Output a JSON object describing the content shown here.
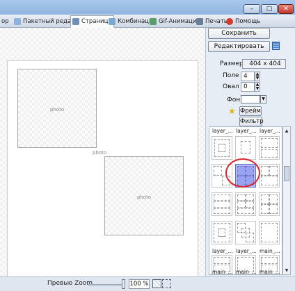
{
  "tabs": [
    {
      "label": "ор"
    },
    {
      "label": "Пакетный редактор"
    },
    {
      "label": "Страница"
    },
    {
      "label": "Комбинация"
    },
    {
      "label": "Gif-Анимация"
    },
    {
      "label": "Печать"
    },
    {
      "label": "Помощь"
    }
  ],
  "window": {
    "min_glyph": "–",
    "max_glyph": "□",
    "close_glyph": "✕"
  },
  "canvas": {
    "photo_label": "photo"
  },
  "statusbar": {
    "zoom_label": "Превью Zoom",
    "zoom_value": "100 %"
  },
  "panel": {
    "save_label": "Сохранить",
    "edit_label": "Редактировать",
    "size_label": "Размер",
    "size_value": "404 x 404",
    "margin_label": "Поле",
    "margin_value": "4",
    "oval_label": "Овал",
    "oval_value": "0",
    "bg_label": "Фон",
    "frame_label": "Фрейм",
    "filter_label": "Фильтр"
  },
  "thumbnails": {
    "row_labels_top": [
      "layer_...",
      "layer_...",
      "layer_..."
    ],
    "row_labels_bottom": [
      "layer_...",
      "layer_...",
      "main_..."
    ],
    "row_labels_last": [
      "main_...",
      "main_...",
      "main_..."
    ]
  },
  "colors": {
    "accent": "#b9bff5",
    "highlight_circle": "#d8262e"
  }
}
